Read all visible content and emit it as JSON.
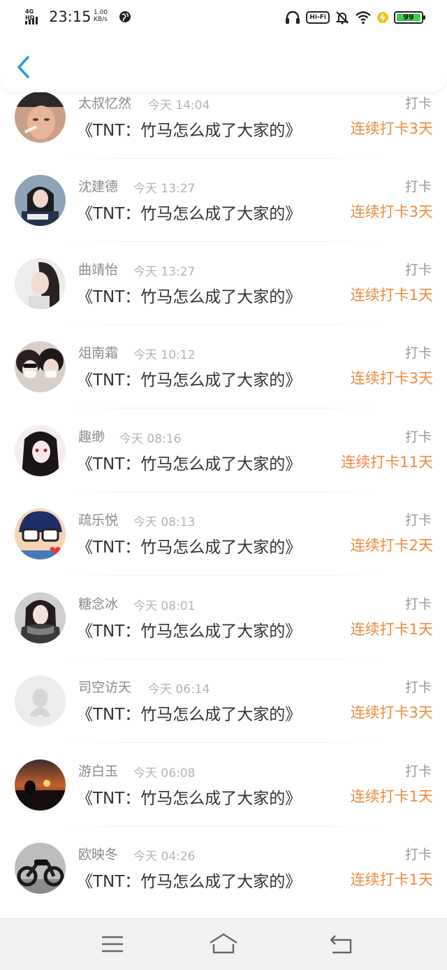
{
  "status_bar": {
    "network": "4G HD",
    "time": "23:15",
    "speed_value": "1.00",
    "speed_unit": "KB/s",
    "wifi6_label": "Hi-Fi",
    "battery_level": "99",
    "battery_color": "#37d24a"
  },
  "header": {
    "back_icon": "chevron-left-icon",
    "accent": "#1e9fe8"
  },
  "entries": [
    {
      "name": "太叔忆然",
      "time": "今天 14:04",
      "title": "《TNT：竹马怎么成了大家的》",
      "action": "打卡",
      "streak": "连续打卡3天"
    },
    {
      "name": "沈建德",
      "time": "今天 13:27",
      "title": "《TNT：竹马怎么成了大家的》",
      "action": "打卡",
      "streak": "连续打卡3天"
    },
    {
      "name": "曲靖怡",
      "time": "今天 13:27",
      "title": "《TNT：竹马怎么成了大家的》",
      "action": "打卡",
      "streak": "连续打卡1天"
    },
    {
      "name": "俎南霜",
      "time": "今天 10:12",
      "title": "《TNT：竹马怎么成了大家的》",
      "action": "打卡",
      "streak": "连续打卡3天"
    },
    {
      "name": "趣缈",
      "time": "今天 08:16",
      "title": "《TNT：竹马怎么成了大家的》",
      "action": "打卡",
      "streak": "连续打卡11天"
    },
    {
      "name": "疏乐悦",
      "time": "今天 08:13",
      "title": "《TNT：竹马怎么成了大家的》",
      "action": "打卡",
      "streak": "连续打卡2天"
    },
    {
      "name": "糖念冰",
      "time": "今天 08:01",
      "title": "《TNT：竹马怎么成了大家的》",
      "action": "打卡",
      "streak": "连续打卡1天"
    },
    {
      "name": "司空访天",
      "time": "今天 06:14",
      "title": "《TNT：竹马怎么成了大家的》",
      "action": "打卡",
      "streak": "连续打卡3天"
    },
    {
      "name": "游白玉",
      "time": "今天 06:08",
      "title": "《TNT：竹马怎么成了大家的》",
      "action": "打卡",
      "streak": "连续打卡1天"
    },
    {
      "name": "欧映冬",
      "time": "今天 04:26",
      "title": "《TNT：竹马怎么成了大家的》",
      "action": "打卡",
      "streak": "连续打卡1天"
    }
  ],
  "navbar": {
    "menu_icon": "menu-icon",
    "home_icon": "home-icon",
    "back_icon": "back-arrow-icon"
  },
  "colors": {
    "streak": "#ef8a3c",
    "name": "#8a8a8a",
    "time": "#b4b4b4",
    "title": "#333333"
  }
}
